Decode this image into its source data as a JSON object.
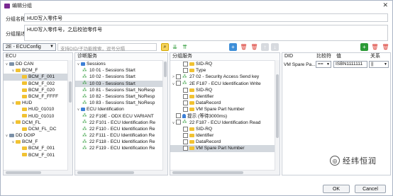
{
  "window": {
    "title": "编辑分组"
  },
  "form": {
    "name_label": "分组名称",
    "name_value": "HUD写入零件号",
    "desc_label": "分组描述",
    "desc_value": "HUD写入零件号，之后校验零件号"
  },
  "toolbar": {
    "ecu_select": "2E - ECUConfig",
    "search_placeholder": "支持DID/子功能搜索，逗号分隔"
  },
  "ecu_panel": {
    "header": "ECU",
    "items": [
      "DD CAN",
      "BCM_F",
      "BCM_F_001",
      "BCM_F_002",
      "BCM_F_020",
      "BCM_F_FFFF",
      "HUD",
      "HUD_01010",
      "HUD_01010",
      "DCM_FL",
      "DCM_FL_DC",
      "DD DOIP",
      "BCM_F",
      "BCM_F_001",
      "BCM_F_001"
    ]
  },
  "diag_panel": {
    "header": "诊断服务",
    "items": [
      "Sessions",
      "10 01 - Sessions Start",
      "10 02 - Sessions Start",
      "10 03 - Sessions Start",
      "10 81 - Sessions Start_NoResp",
      "10 82 - Sessions Start_NoResp",
      "10 83 - Sessions Start_NoResp",
      "ECU Identification",
      "22 F19E - ODX ECU VARIANT",
      "22 F101 - ECU Identification Re",
      "22 F110 - ECU Identification Re",
      "22 F111 - ECU Identification Re",
      "22 F118 - ECU Identification Re",
      "22 F119 - ECU Identification Re"
    ]
  },
  "group_panel": {
    "header": "分组服务",
    "items": [
      "SID-RQ",
      "Type",
      "27 02 - Security Access Send key",
      "2E F187 - ECU Identification Write",
      "SID-RQ",
      "Identifier",
      "DataRecord",
      "VM Spare Part Number",
      "提示 (等待3000ms)",
      "22 F187 - ECU Identification Read",
      "SID-RQ",
      "Identifier",
      "DataRecord",
      "VM Spare Part Number"
    ]
  },
  "param_table": {
    "headers": [
      "DID",
      "比较符",
      "值",
      "关系"
    ],
    "row": {
      "did": "VM Spare Pa...",
      "op": "==",
      "value": "ISBN1111111",
      "rel": "||"
    }
  },
  "watermark": {
    "text": "经纬恒润"
  },
  "buttons": {
    "ok": "OK",
    "cancel": "Cancel"
  },
  "colors": {
    "accent_green": "#2b9a36",
    "selection": "#d3d8de",
    "folder": "#f1c232",
    "delete_red": "#d9342b"
  }
}
